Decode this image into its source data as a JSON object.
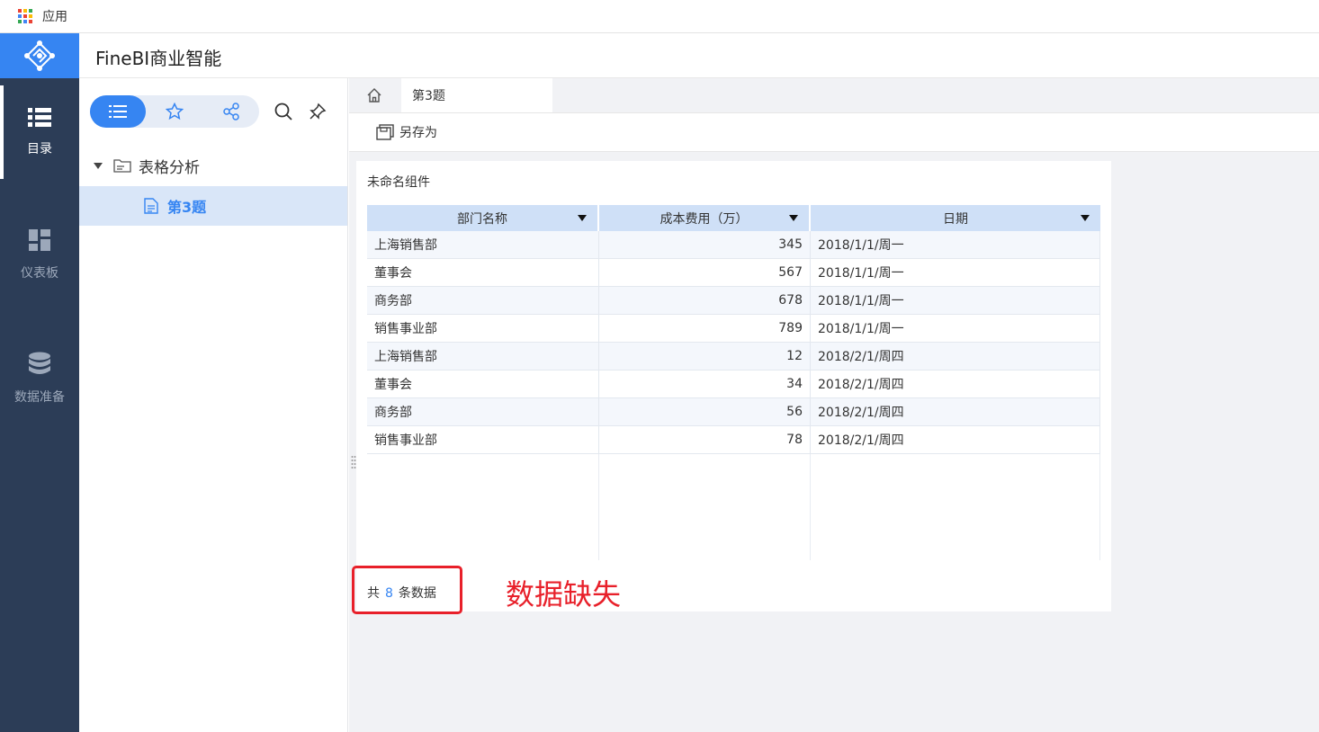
{
  "bookmarks": {
    "apps_label": "应用",
    "apps_icon": "apps-grid-icon"
  },
  "header": {
    "title": "FineBI商业智能",
    "logo_icon": "finebi-logo-icon"
  },
  "nav": {
    "items": [
      {
        "label": "目录",
        "icon": "list-icon",
        "active": true
      },
      {
        "label": "仪表板",
        "icon": "dashboard-icon",
        "active": false
      },
      {
        "label": "数据准备",
        "icon": "database-icon",
        "active": false
      }
    ]
  },
  "tree": {
    "segments": [
      "list-icon",
      "star-icon",
      "share-icon"
    ],
    "tools": [
      "search-icon",
      "pin-icon"
    ],
    "folder": {
      "label": "表格分析"
    },
    "file": {
      "label": "第3题"
    }
  },
  "tabs": {
    "active": "第3题"
  },
  "toolbar": {
    "save_as": "另存为"
  },
  "widget": {
    "title": "未命名组件",
    "columns": [
      "部门名称",
      "成本费用（万）",
      "日期"
    ],
    "rows": [
      [
        "上海销售部",
        "345",
        "2018/1/1/周一"
      ],
      [
        "董事会",
        "567",
        "2018/1/1/周一"
      ],
      [
        "商务部",
        "678",
        "2018/1/1/周一"
      ],
      [
        "销售事业部",
        "789",
        "2018/1/1/周一"
      ],
      [
        "上海销售部",
        "12",
        "2018/2/1/周四"
      ],
      [
        "董事会",
        "34",
        "2018/2/1/周四"
      ],
      [
        "商务部",
        "56",
        "2018/2/1/周四"
      ],
      [
        "销售事业部",
        "78",
        "2018/2/1/周四"
      ]
    ],
    "footer": {
      "prefix": "共",
      "count": "8",
      "suffix": "条数据"
    }
  },
  "annotation": {
    "text": "数据缺失",
    "color": "#e8202a"
  },
  "colors": {
    "accent": "#3685f2",
    "nav_bg": "#2c3d57",
    "header_row": "#cfe0f7"
  }
}
